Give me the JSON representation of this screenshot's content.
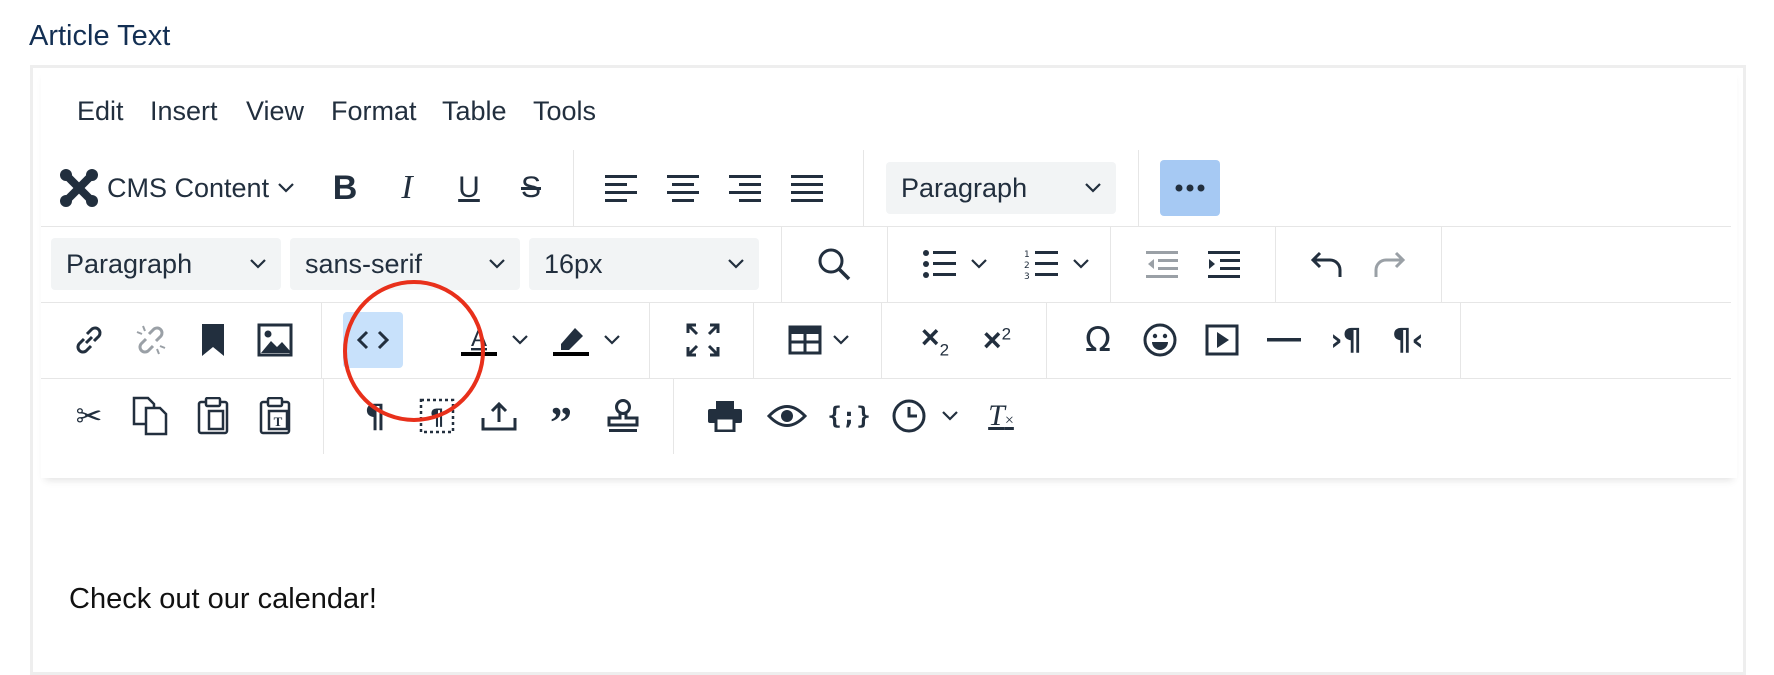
{
  "field_label": "Article Text",
  "menubar": [
    "Edit",
    "Insert",
    "View",
    "Format",
    "Table",
    "Tools"
  ],
  "toolbar": {
    "cms_content_label": "CMS Content",
    "block_format_row1": "Paragraph",
    "block_format_row2": "Paragraph",
    "font_family": "sans-serif",
    "font_size": "16px"
  },
  "content": {
    "text": "Check out our calendar!"
  },
  "colors": {
    "accent": "#c8e1fb",
    "more_button": "#a6c9f3",
    "annotation": "#e8301b",
    "label": "#132f53",
    "icon": "#222f3e"
  },
  "icons": [
    "joomla-icon",
    "bold-icon",
    "italic-icon",
    "underline-icon",
    "strikethrough-icon",
    "align-left-icon",
    "align-center-icon",
    "align-right-icon",
    "align-justify-icon",
    "more-icon",
    "search-icon",
    "bullet-list-icon",
    "numbered-list-icon",
    "outdent-icon",
    "indent-icon",
    "undo-icon",
    "redo-icon",
    "link-icon",
    "unlink-icon",
    "bookmark-icon",
    "image-icon",
    "code-icon",
    "text-color-icon",
    "highlight-icon",
    "fullscreen-icon",
    "table-icon",
    "subscript-icon",
    "superscript-icon",
    "omega-icon",
    "emoji-icon",
    "media-icon",
    "horizontal-line-icon",
    "ltr-icon",
    "rtl-icon",
    "cut-icon",
    "copy-icon",
    "paste-icon",
    "paste-text-icon",
    "show-blocks-icon",
    "visual-blocks-icon",
    "upload-icon",
    "blockquote-icon",
    "stamp-icon",
    "print-icon",
    "preview-icon",
    "code-sample-icon",
    "clock-icon",
    "clear-format-icon"
  ]
}
